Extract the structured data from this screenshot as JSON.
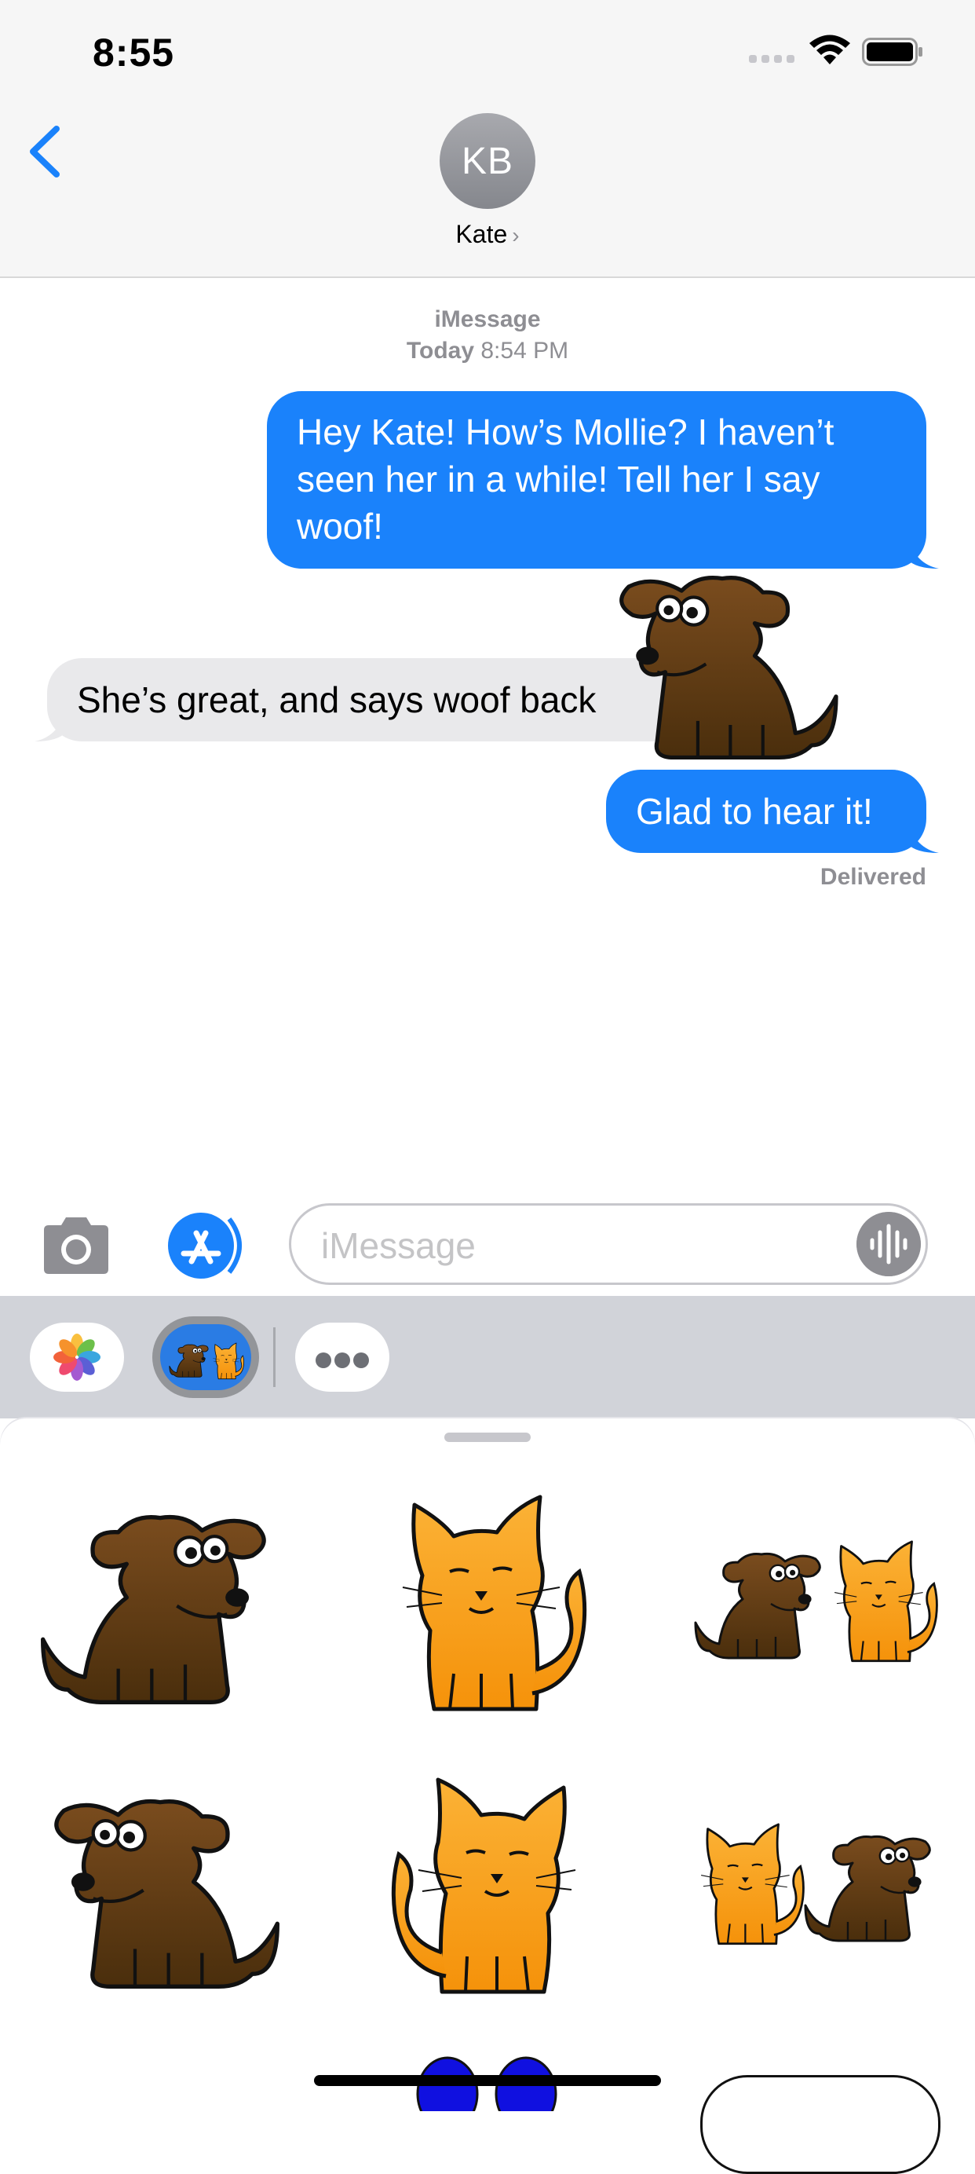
{
  "status_bar": {
    "time": "8:55"
  },
  "header": {
    "avatar_initials": "KB",
    "contact_name": "Kate",
    "contact_chevron": "›",
    "icons": [
      "back-chevron-icon",
      "signal-icon",
      "wifi-icon",
      "battery-icon"
    ]
  },
  "conversation": {
    "service": "iMessage",
    "day": "Today",
    "time": "8:54 PM",
    "messages": [
      {
        "from": "me",
        "text": "Hey Kate! How’s Mollie? I haven’t seen her in a while! Tell her I say woof!"
      },
      {
        "from": "them",
        "text": "She’s great, and says woof back"
      },
      {
        "from": "me",
        "text": "Glad to hear it!"
      }
    ],
    "delivery_status": "Delivered",
    "placed_sticker": "dog-sticker"
  },
  "compose": {
    "placeholder": "iMessage",
    "icons": [
      "camera-icon",
      "app-store-icon",
      "audio-waveform-icon"
    ]
  },
  "app_drawer": {
    "apps": [
      "photos-app-icon",
      "dog-cat-sticker-app-icon",
      "more-apps-icon"
    ]
  },
  "sticker_panel": {
    "stickers": [
      "dog-facing-right",
      "cat-facing-left",
      "dog-and-cat",
      "dog-facing-left",
      "cat-facing-right",
      "cat-and-dog"
    ]
  },
  "colors": {
    "sent_bubble": "#1a82fb",
    "received_bubble": "#e9e9eb",
    "accent": "#1a82fb",
    "dog_brown": "#5c3a14",
    "cat_orange": "#f7940e"
  }
}
